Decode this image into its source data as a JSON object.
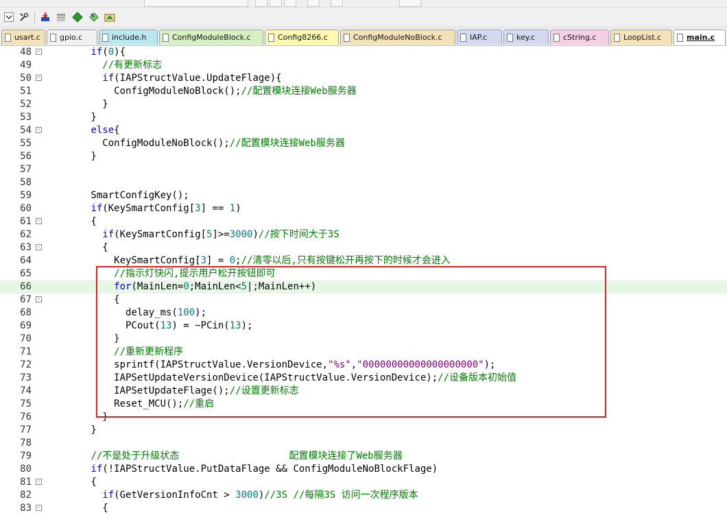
{
  "tabs": [
    {
      "label": "usart.c",
      "color": "#f3e2b8",
      "active": false
    },
    {
      "label": "gpio.c",
      "color": "#f0f0f0",
      "active": false
    },
    {
      "label": "include.h",
      "color": "#b8e8ee",
      "active": false
    },
    {
      "label": "ConfigModuleBlock.c",
      "color": "#d6f0c4",
      "active": false
    },
    {
      "label": "Config8266.c",
      "color": "#fff8b0",
      "active": false
    },
    {
      "label": "ConfigModuleNoBlock.c",
      "color": "#f3e2b8",
      "active": false
    },
    {
      "label": "IAP.c",
      "color": "#d4d8f0",
      "active": false
    },
    {
      "label": "key.c",
      "color": "#d4d8f0",
      "active": false
    },
    {
      "label": "cString.c",
      "color": "#f4d0e4",
      "active": false
    },
    {
      "label": "LoopList.c",
      "color": "#f3e2b8",
      "active": false
    },
    {
      "label": "main.c",
      "color": "#ffffff",
      "active": true
    }
  ],
  "lines": [
    {
      "n": "48",
      "fold": "-",
      "t": [
        [
          "        ",
          ""
        ],
        [
          "if",
          "kw"
        ],
        [
          "(",
          ""
        ],
        [
          "0",
          "num"
        ],
        [
          "){",
          ""
        ]
      ]
    },
    {
      "n": "49",
      "t": [
        [
          "          ",
          ""
        ],
        [
          "//有更新标志",
          "cm"
        ]
      ]
    },
    {
      "n": "50",
      "fold": "-",
      "t": [
        [
          "          ",
          ""
        ],
        [
          "if",
          "kw"
        ],
        [
          "(IAPStructValue.UpdateFlage){",
          ""
        ]
      ]
    },
    {
      "n": "51",
      "t": [
        [
          "            ConfigModuleNoBlock();",
          ""
        ],
        [
          "//配置模块连接Web服务器",
          "cm"
        ]
      ]
    },
    {
      "n": "52",
      "t": [
        [
          "          }",
          ""
        ]
      ]
    },
    {
      "n": "53",
      "t": [
        [
          "        }",
          ""
        ]
      ]
    },
    {
      "n": "54",
      "fold": "-",
      "t": [
        [
          "        ",
          ""
        ],
        [
          "else",
          "kw"
        ],
        [
          "{",
          ""
        ]
      ]
    },
    {
      "n": "55",
      "t": [
        [
          "          ConfigModuleNoBlock();",
          ""
        ],
        [
          "//配置模块连接Web服务器",
          "cm"
        ]
      ]
    },
    {
      "n": "56",
      "t": [
        [
          "        }",
          ""
        ]
      ]
    },
    {
      "n": "57",
      "t": []
    },
    {
      "n": "58",
      "t": []
    },
    {
      "n": "59",
      "t": [
        [
          "        SmartConfigKey();",
          ""
        ]
      ]
    },
    {
      "n": "60",
      "t": [
        [
          "        ",
          ""
        ],
        [
          "if",
          "kw"
        ],
        [
          "(KeySmartConfig[",
          ""
        ],
        [
          "3",
          "num"
        ],
        [
          "] == ",
          ""
        ],
        [
          "1",
          "num"
        ],
        [
          ")",
          ""
        ]
      ]
    },
    {
      "n": "61",
      "fold": "-",
      "t": [
        [
          "        {",
          ""
        ]
      ]
    },
    {
      "n": "62",
      "t": [
        [
          "          ",
          ""
        ],
        [
          "if",
          "kw"
        ],
        [
          "(KeySmartConfig[",
          ""
        ],
        [
          "5",
          "num"
        ],
        [
          "]>=",
          ""
        ],
        [
          "3000",
          "num"
        ],
        [
          ")",
          ""
        ],
        [
          "//按下时间大于3S",
          "cm"
        ]
      ]
    },
    {
      "n": "63",
      "fold": "-",
      "t": [
        [
          "          {",
          ""
        ]
      ]
    },
    {
      "n": "64",
      "t": [
        [
          "            KeySmartConfig[",
          ""
        ],
        [
          "3",
          "num"
        ],
        [
          "] = ",
          ""
        ],
        [
          "0",
          "num"
        ],
        [
          ";",
          ""
        ],
        [
          "//清零以后,只有按键松开再按下的时候才会进入",
          "cm"
        ]
      ]
    },
    {
      "n": "65",
      "t": [
        [
          "            ",
          ""
        ],
        [
          "//指示灯快闪,提示用户松开按钮即可",
          "cm"
        ]
      ]
    },
    {
      "n": "66",
      "hl": true,
      "t": [
        [
          "            ",
          ""
        ],
        [
          "for",
          "kw"
        ],
        [
          "(MainLen=",
          ""
        ],
        [
          "0",
          "num"
        ],
        [
          ";MainLen<",
          ""
        ],
        [
          "5",
          "num"
        ],
        [
          "|;MainLen++)",
          ""
        ]
      ]
    },
    {
      "n": "67",
      "fold": "-",
      "t": [
        [
          "            {",
          ""
        ]
      ]
    },
    {
      "n": "68",
      "t": [
        [
          "              delay_ms(",
          ""
        ],
        [
          "100",
          "num"
        ],
        [
          ");",
          ""
        ]
      ]
    },
    {
      "n": "69",
      "t": [
        [
          "              PCout(",
          ""
        ],
        [
          "13",
          "num"
        ],
        [
          ") = ~PCin(",
          ""
        ],
        [
          "13",
          "num"
        ],
        [
          ");",
          ""
        ]
      ]
    },
    {
      "n": "70",
      "t": [
        [
          "            }",
          ""
        ]
      ]
    },
    {
      "n": "71",
      "t": [
        [
          "            ",
          ""
        ],
        [
          "//重新更新程序",
          "cm"
        ]
      ]
    },
    {
      "n": "72",
      "t": [
        [
          "            sprintf(IAPStructValue.VersionDevice,",
          ""
        ],
        [
          "\"%s\"",
          "str"
        ],
        [
          ",",
          ""
        ],
        [
          "\"00000000000000000000\"",
          "str"
        ],
        [
          ");",
          ""
        ]
      ]
    },
    {
      "n": "73",
      "t": [
        [
          "            IAPSetUpdateVersionDevice(IAPStructValue.VersionDevice);",
          ""
        ],
        [
          "//设备版本初始值",
          "cm"
        ]
      ]
    },
    {
      "n": "74",
      "t": [
        [
          "            IAPSetUpdateFlage();",
          ""
        ],
        [
          "//设置更新标志",
          "cm"
        ]
      ]
    },
    {
      "n": "75",
      "t": [
        [
          "            Reset_MCU();",
          ""
        ],
        [
          "//重启",
          "cm"
        ]
      ]
    },
    {
      "n": "76",
      "t": [
        [
          "          }",
          ""
        ]
      ]
    },
    {
      "n": "77",
      "t": [
        [
          "        }",
          ""
        ]
      ]
    },
    {
      "n": "78",
      "t": []
    },
    {
      "n": "79",
      "t": [
        [
          "        ",
          ""
        ],
        [
          "//不是处于升级状态                   配置模块连接了Web服务器",
          "cm"
        ]
      ]
    },
    {
      "n": "80",
      "t": [
        [
          "        ",
          ""
        ],
        [
          "if",
          "kw"
        ],
        [
          "(!IAPStructValue.PutDataFlage && ConfigModuleNoBlockFlage)",
          ""
        ]
      ]
    },
    {
      "n": "81",
      "fold": "-",
      "t": [
        [
          "        {",
          ""
        ]
      ]
    },
    {
      "n": "82",
      "t": [
        [
          "          ",
          ""
        ],
        [
          "if",
          "kw"
        ],
        [
          "(GetVersionInfoCnt > ",
          ""
        ],
        [
          "3000",
          "num"
        ],
        [
          ")",
          ""
        ],
        [
          "//3S //每隔3S 访问一次程序版本",
          "cm"
        ]
      ]
    },
    {
      "n": "83",
      "fold": "-",
      "t": [
        [
          "          {",
          ""
        ]
      ]
    }
  ]
}
